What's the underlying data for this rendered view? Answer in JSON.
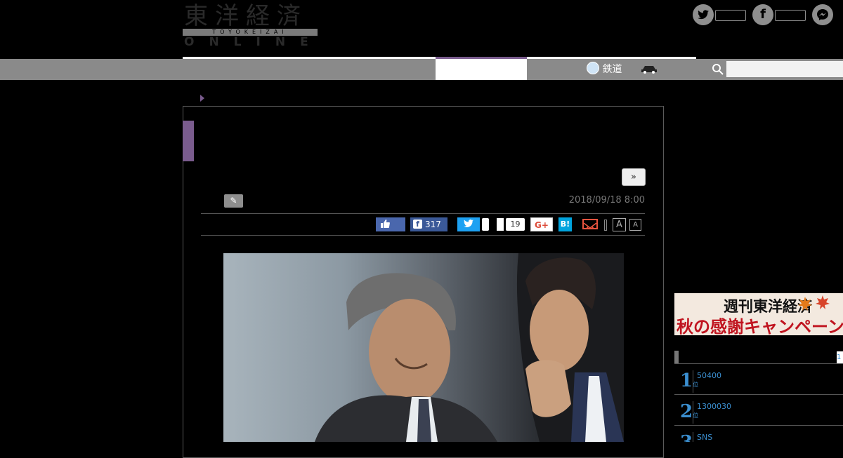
{
  "header": {
    "logo_jp": "東洋経済",
    "logo_en": "TOYOKEIZAI",
    "logo_online": "ONLINE"
  },
  "nav": {
    "items": [
      {
        "label": "鉄道",
        "icon": "train-icon"
      },
      {
        "label": "",
        "icon": "car-icon"
      }
    ],
    "search_placeholder": ""
  },
  "article": {
    "next_label": "»",
    "date": "2018/09/18 8:00",
    "share": {
      "fb_count": "317",
      "count": "19",
      "gplus_label": "G+",
      "hatena_label": "B!",
      "font_large": "A",
      "font_small": "A"
    }
  },
  "sidebar": {
    "banner_line1": "週刊東洋経済",
    "banner_line2": "秋の感謝キャンペーン",
    "ranking_tab": "1",
    "ranking": [
      {
        "rank": "1",
        "suffix": "位",
        "text": "50400"
      },
      {
        "rank": "2",
        "suffix": "位",
        "text": "1300030"
      },
      {
        "rank": "3",
        "suffix": "位",
        "text": "SNS"
      }
    ]
  },
  "colors": {
    "accent": "#7a5c8e",
    "link": "#3b8fd0",
    "nav": "#8a8a8a"
  }
}
